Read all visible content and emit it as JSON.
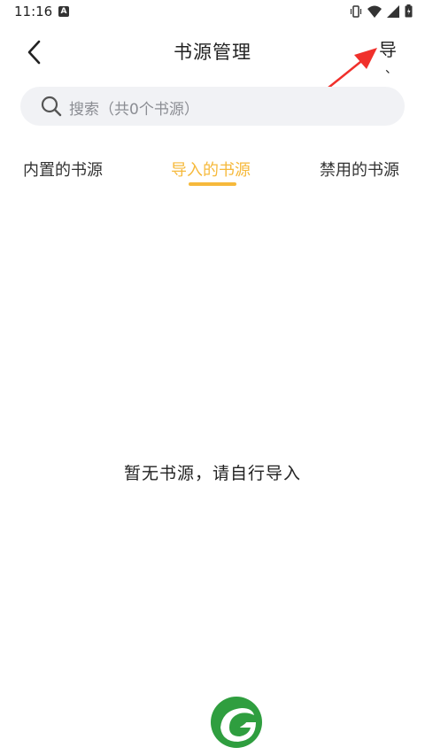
{
  "status": {
    "time": "11:16",
    "badge": "A"
  },
  "header": {
    "title": "书源管理",
    "import_label": "导",
    "import_sub": "、"
  },
  "search": {
    "placeholder": "搜索（共0个书源）"
  },
  "tabs": [
    {
      "label": "内置的书源",
      "active": false
    },
    {
      "label": "导入的书源",
      "active": true
    },
    {
      "label": "禁用的书源",
      "active": false
    }
  ],
  "empty_text": "暂无书源，请自行导入",
  "colors": {
    "accent": "#f6b93b",
    "search_bg": "#f1f2f5",
    "arrow": "#f0302b",
    "logo_green": "#2f9e3f"
  },
  "icons": [
    "back-icon",
    "search-icon",
    "vibrate-icon",
    "wifi-icon",
    "signal-icon",
    "battery-icon",
    "app-logo-icon"
  ]
}
